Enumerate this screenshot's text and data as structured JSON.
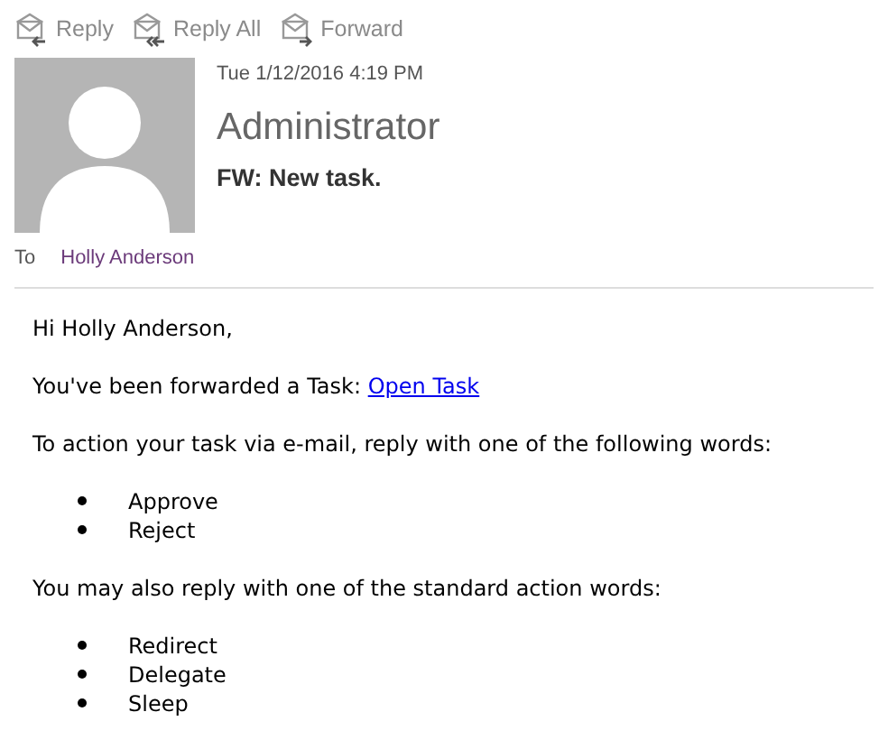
{
  "toolbar": [
    {
      "label": "Reply",
      "kind": "reply"
    },
    {
      "label": "Reply All",
      "kind": "replyall"
    },
    {
      "label": "Forward",
      "kind": "forward"
    }
  ],
  "message": {
    "date": "Tue 1/12/2016 4:19 PM",
    "sender": "Administrator",
    "subject": "FW: New task.",
    "to_label": "To",
    "to": "Holly Anderson"
  },
  "body": [
    {
      "kind": "text",
      "text": "Hi Holly Anderson,"
    },
    {
      "kind": "text",
      "text": "You've been forwarded a Task:",
      "link": "Open Task"
    },
    {
      "kind": "text",
      "text": "To action your task via e-mail, reply with one of the following words:"
    },
    {
      "kind": "list",
      "items": [
        "Approve",
        "Reject"
      ]
    },
    {
      "kind": "text",
      "text": "You may also reply with one of the standard action words:"
    },
    {
      "kind": "list",
      "items": [
        "Redirect",
        "Delegate",
        "Sleep"
      ]
    }
  ]
}
